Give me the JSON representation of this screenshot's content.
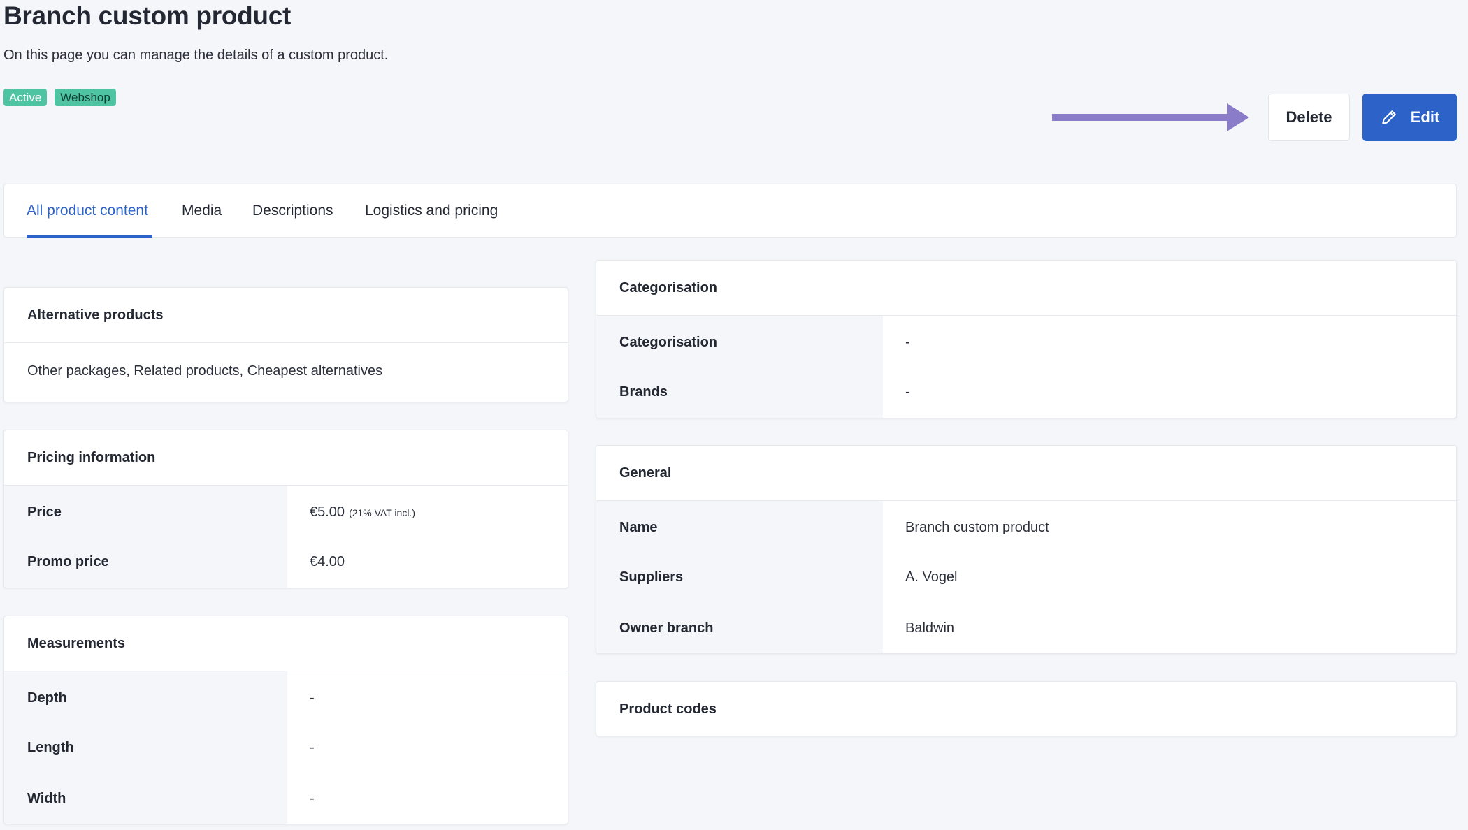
{
  "page": {
    "title": "Branch custom product",
    "subtitle": "On this page you can manage the details of a custom product.",
    "badges": [
      "Active",
      "Webshop"
    ]
  },
  "actions": {
    "delete_label": "Delete",
    "edit_label": "Edit"
  },
  "annotation": {
    "arrow_color": "#8a7cc9"
  },
  "tabs": [
    {
      "label": "All product content",
      "selected": true
    },
    {
      "label": "Media"
    },
    {
      "label": "Descriptions"
    },
    {
      "label": "Logistics and pricing"
    }
  ],
  "alternative_products": {
    "title": "Alternative products",
    "text": "Other packages, Related products, Cheapest alternatives"
  },
  "pricing": {
    "title": "Pricing information",
    "rows": [
      {
        "label": "Price",
        "value": "€5.00",
        "note": "(21% VAT incl.)"
      },
      {
        "label": "Promo price",
        "value": "€4.00"
      }
    ]
  },
  "measurements": {
    "title": "Measurements",
    "rows": [
      {
        "label": "Depth",
        "value": "-"
      },
      {
        "label": "Length",
        "value": "-"
      },
      {
        "label": "Width",
        "value": "-"
      }
    ]
  },
  "categorisation": {
    "title": "Categorisation",
    "rows": [
      {
        "label": "Categorisation",
        "value": "-"
      },
      {
        "label": "Brands",
        "value": "-"
      }
    ]
  },
  "general": {
    "title": "General",
    "rows": [
      {
        "label": "Name",
        "value": "Branch custom product"
      },
      {
        "label": "Suppliers",
        "value": "A. Vogel"
      },
      {
        "label": "Owner branch",
        "value": "Baldwin"
      }
    ]
  },
  "product_codes": {
    "title": "Product codes"
  },
  "colors": {
    "accent": "#2d62c9",
    "badge": "#4fc4a3",
    "background": "#f5f6f9"
  }
}
